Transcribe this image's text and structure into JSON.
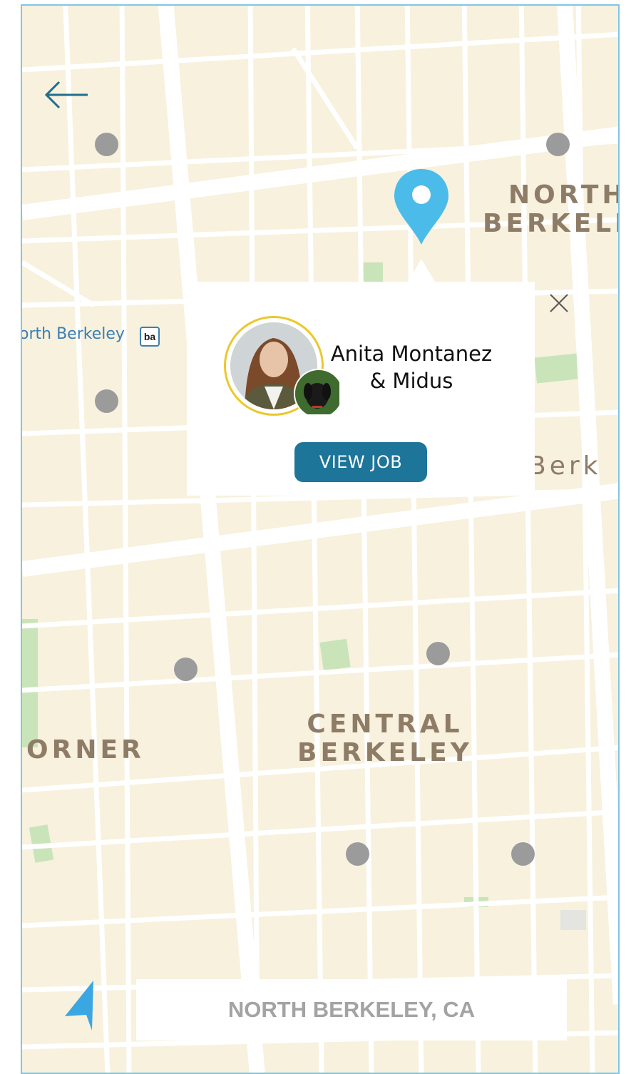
{
  "map": {
    "area_labels": {
      "north_berkeley_line1": "NORTH",
      "north_berkeley_line2": "BERKELE",
      "central_line1": "CENTRAL",
      "central_line2": "BERKELEY",
      "corner": "ORNER",
      "berk": "Berk"
    },
    "station": {
      "label": "orth Berkeley",
      "badge": "ba"
    },
    "colors": {
      "background": "#f7f1de",
      "road": "#ffffff",
      "park": "#c9e4b9",
      "marker": "#9b9b9b",
      "pin": "#4bbbea",
      "accent": "#1d7599",
      "avatar_ring": "#ecc82d"
    }
  },
  "popup": {
    "name_line1": "Anita Montanez",
    "name_line2": "& Midus",
    "view_job_label": "VIEW JOB"
  },
  "location_bar": {
    "text": "NORTH BERKELEY, CA"
  },
  "icons": [
    "back-arrow-icon",
    "close-icon",
    "location-pin-icon",
    "navigation-arrow-icon"
  ]
}
